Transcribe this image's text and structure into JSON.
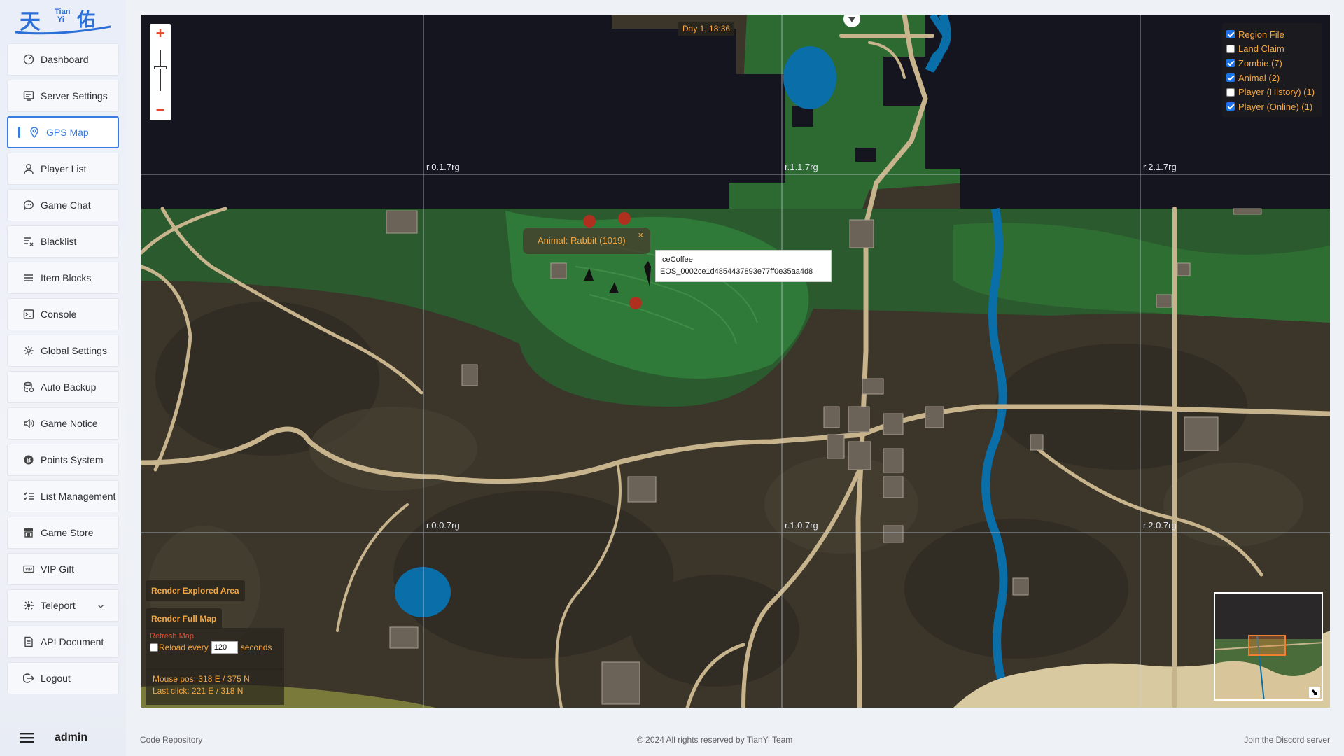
{
  "brand": {
    "cn": "天",
    "sub_top": "Tian",
    "sub_bottom": "Yi",
    "cn2": "佑"
  },
  "nav": [
    {
      "label": "Dashboard",
      "icon": "dashboard-icon"
    },
    {
      "label": "Server Settings",
      "icon": "server-settings-icon"
    },
    {
      "label": "GPS Map",
      "icon": "location-pin-icon",
      "active": true
    },
    {
      "label": "Player List",
      "icon": "user-icon"
    },
    {
      "label": "Game Chat",
      "icon": "chat-bubble-icon"
    },
    {
      "label": "Blacklist",
      "icon": "blacklist-icon"
    },
    {
      "label": "Item Blocks",
      "icon": "list-icon"
    },
    {
      "label": "Console",
      "icon": "terminal-icon"
    },
    {
      "label": "Global Settings",
      "icon": "gear-icon"
    },
    {
      "label": "Auto Backup",
      "icon": "database-icon"
    },
    {
      "label": "Game Notice",
      "icon": "speaker-icon"
    },
    {
      "label": "Points System",
      "icon": "coin-icon"
    },
    {
      "label": "List Management",
      "icon": "checklist-icon"
    },
    {
      "label": "Game Store",
      "icon": "store-icon"
    },
    {
      "label": "VIP Gift",
      "icon": "vip-icon"
    },
    {
      "label": "Teleport",
      "icon": "teleport-icon",
      "has_submenu": true
    },
    {
      "label": "API Document",
      "icon": "document-icon"
    },
    {
      "label": "Logout",
      "icon": "logout-icon"
    }
  ],
  "user": {
    "name": "admin"
  },
  "map": {
    "time": "Day 1, 18:36",
    "zoom_in": "+",
    "zoom_out": "–",
    "grid_labels": [
      "r.0.1.7rg",
      "r.1.1.7rg",
      "r.2.1.7rg",
      "r.0.0.7rg",
      "r.1.0.7rg",
      "r.2.0.7rg"
    ],
    "layers": [
      {
        "label": "Region File",
        "checked": true
      },
      {
        "label": "Land Claim",
        "checked": false
      },
      {
        "label": "Zombie (7)",
        "checked": true
      },
      {
        "label": "Animal (2)",
        "checked": true
      },
      {
        "label": "Player (History) (1)",
        "checked": false
      },
      {
        "label": "Player (Online) (1)",
        "checked": true
      }
    ],
    "animal_tooltip": "Animal: Rabbit (1019)",
    "animal_tooltip_close": "×",
    "player_tooltip": {
      "name": "IceCoffee",
      "id": "EOS_0002ce1d4854437893e77ff0e35aa4d8"
    },
    "render_explored": "Render Explored Area",
    "render_full": "Render Full Map",
    "refresh_title": "Refresh Map",
    "reload_label": "Reload every",
    "reload_value": "120",
    "reload_unit": "seconds",
    "mouse_pos": "Mouse pos: 318 E / 375 N",
    "last_click": "Last click: 221 E / 318 N",
    "minimap_expand": "⬊"
  },
  "footer": {
    "left": "Code Repository",
    "center": "© 2024 All rights reserved by TianYi Team",
    "right": "Join the Discord server"
  }
}
